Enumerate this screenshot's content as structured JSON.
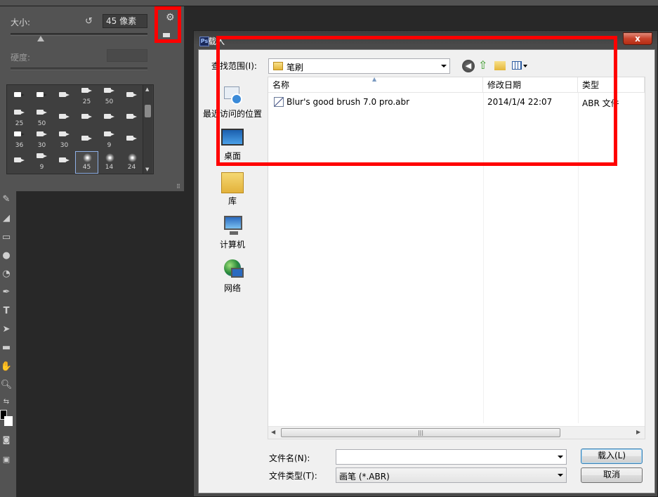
{
  "brush_panel": {
    "size_label": "大小:",
    "size_value": "45 像素",
    "hardness_label": "硬度:",
    "size_slider_fraction": 0.2,
    "presets": [
      {
        "size": ""
      },
      {
        "size": ""
      },
      {
        "size": ""
      },
      {
        "size": "25"
      },
      {
        "size": "50"
      },
      {
        "size": ""
      },
      {
        "size": "25"
      },
      {
        "size": "50"
      },
      {
        "size": ""
      },
      {
        "size": ""
      },
      {
        "size": ""
      },
      {
        "size": ""
      },
      {
        "size": "36"
      },
      {
        "size": "30"
      },
      {
        "size": "30"
      },
      {
        "size": ""
      },
      {
        "size": "9"
      },
      {
        "size": ""
      },
      {
        "size": ""
      },
      {
        "size": "9"
      },
      {
        "size": ""
      },
      {
        "size": "45"
      },
      {
        "size": "14"
      },
      {
        "size": "24"
      }
    ]
  },
  "dialog": {
    "title": "载入",
    "close_label": "x",
    "look_in_label": "查找范围(I):",
    "look_in_value": "笔刷",
    "places": [
      "最近访问的位置",
      "桌面",
      "库",
      "计算机",
      "网络"
    ],
    "columns": [
      "名称",
      "修改日期",
      "类型"
    ],
    "files": [
      {
        "name": "Blur's good brush 7.0 pro.abr",
        "date": "2014/1/4 22:07",
        "type": "ABR 文件"
      }
    ],
    "filename_label": "文件名(N):",
    "filename_value": "",
    "filetype_label": "文件类型(T):",
    "filetype_value": "画笔 (*.ABR)",
    "load_button": "载入(L)",
    "cancel_button": "取消"
  },
  "colors": {
    "highlight": "#ff0000",
    "panel_bg": "#535353",
    "dialog_client": "#f0f0f0"
  }
}
